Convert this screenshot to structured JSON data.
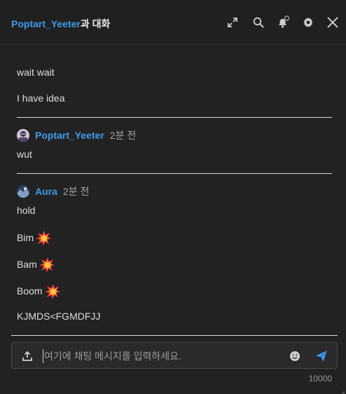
{
  "header": {
    "partner_name": "Poptart_Yeeter",
    "title_suffix": "과 대화"
  },
  "messages": {
    "early": [
      "wait wait",
      "I have idea"
    ],
    "group1": {
      "author": "Poptart_Yeeter",
      "time": "2분 전",
      "lines": [
        "wut"
      ]
    },
    "group2": {
      "author": "Aura",
      "time": "2분 전",
      "lines": [
        "hold",
        "Bim",
        "Bam",
        "Boom",
        "KJMDS<FGMDFJJ"
      ]
    }
  },
  "composer": {
    "placeholder": "여기에 채팅 메시지를 입력하세요.",
    "char_limit": "10000"
  },
  "icons": {
    "expand": "expand-icon",
    "search": "search-icon",
    "bell": "bell-icon",
    "settings": "gear-icon",
    "close": "close-icon",
    "upload": "upload-icon",
    "emoji": "smiley-icon",
    "send": "send-icon"
  },
  "colors": {
    "accent": "#3d9be9",
    "background": "#222222"
  }
}
